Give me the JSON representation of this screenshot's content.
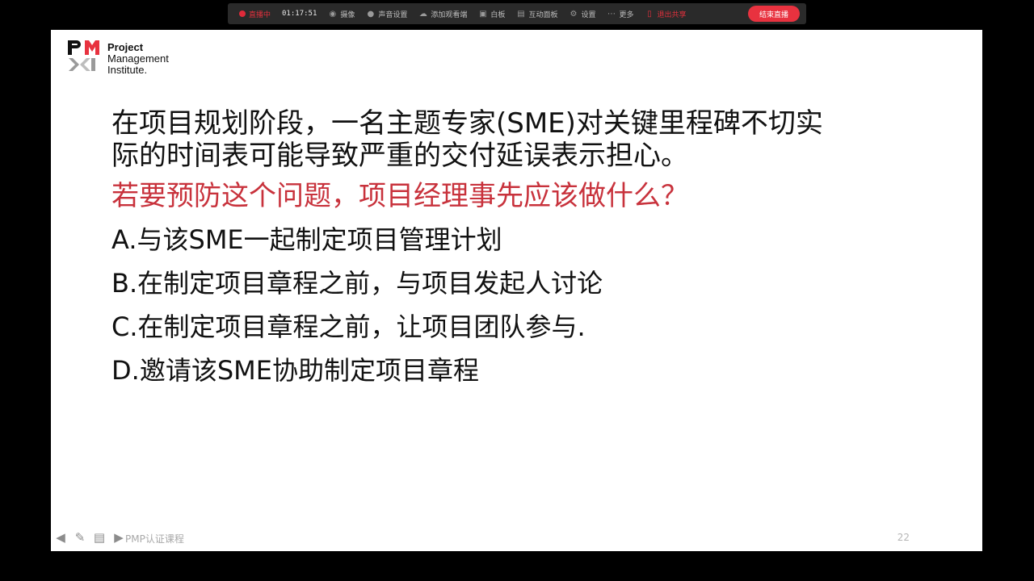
{
  "toolbar": {
    "live_label": "直播中",
    "timer": "01:17:51",
    "camera_label": "摄像",
    "mic_label": "声音设置",
    "add_label": "添加观看端",
    "whiteboard_label": "白板",
    "interact_label": "互动面板",
    "settings_label": "设置",
    "more_label": "更多",
    "exit_label": "退出共享",
    "end_label": "结束直播"
  },
  "slide": {
    "logo": {
      "line1": "Project",
      "line2": "Management",
      "line3": "Institute."
    },
    "question_line1": "在项目规划阶段，一名主题专家(SME)对关键里程碑不切实",
    "question_line2": "际的时间表可能导致严重的交付延误表示担心。",
    "question_red": "若要预防这个问题，项目经理事先应该做什么？",
    "options": [
      "A.与该SME一起制定项目管理计划",
      "B.在制定项目章程之前，与项目发起人讨论",
      "C.在制定项目章程之前，让项目团队参与.",
      "D.邀请该SME协助制定项目章程"
    ],
    "footer_text": "PMP认证课程",
    "page_number": "22"
  },
  "colors": {
    "accent_red": "#c8323c",
    "live_red": "#e0303c",
    "end_button": "#e8323f",
    "pmi_red": "#e8323f"
  },
  "icons": [
    "rec-dot",
    "camera-icon",
    "mic-icon",
    "add-viewer-icon",
    "whiteboard-icon",
    "interact-icon",
    "settings-icon",
    "more-icon",
    "exit-share-icon",
    "prev-arrow-icon",
    "pen-icon",
    "slides-icon",
    "next-arrow-icon"
  ]
}
